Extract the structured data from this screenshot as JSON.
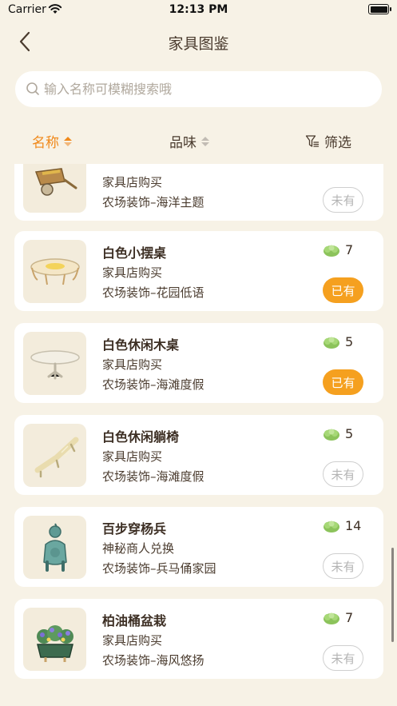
{
  "status_bar": {
    "carrier": "Carrier",
    "time": "12:13 PM"
  },
  "nav": {
    "title": "家具图鉴"
  },
  "search": {
    "placeholder": "输入名称可模糊搜索哦",
    "value": ""
  },
  "sort": {
    "name_label": "名称",
    "taste_label": "品味",
    "filter_label": "筛选"
  },
  "colors": {
    "accent": "#f0891b",
    "owned_badge": "#f5a01f",
    "background": "#f7f2e6"
  },
  "items": [
    {
      "name": "",
      "source": "家具店购买",
      "category": "农场装饰–海洋主题",
      "price": "",
      "status": "未有",
      "icon": "wheelbarrow-icon"
    },
    {
      "name": "白色小摆桌",
      "source": "家具店购买",
      "category": "农场装饰–花园低语",
      "price": "7",
      "status": "已有",
      "icon": "round-table-icon"
    },
    {
      "name": "白色休闲木桌",
      "source": "家具店购买",
      "category": "农场装饰–海滩度假",
      "price": "5",
      "status": "已有",
      "icon": "wooden-table-icon"
    },
    {
      "name": "白色休闲躺椅",
      "source": "家具店购买",
      "category": "农场装饰–海滩度假",
      "price": "5",
      "status": "未有",
      "icon": "lounge-chair-icon"
    },
    {
      "name": "百步穿杨兵",
      "source": "神秘商人兑换",
      "category": "农场装饰–兵马俑家园",
      "price": "14",
      "status": "未有",
      "icon": "terracotta-soldier-icon"
    },
    {
      "name": "柏油桶盆栽",
      "source": "家具店购买",
      "category": "农场装饰–海风悠扬",
      "price": "7",
      "status": "未有",
      "icon": "barrel-planter-icon"
    }
  ]
}
